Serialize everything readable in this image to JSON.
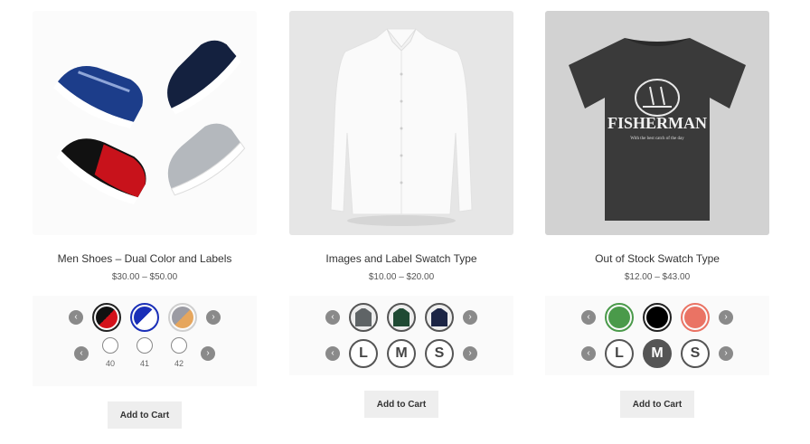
{
  "products": [
    {
      "title": "Men Shoes – Dual Color and Labels",
      "price": "$30.00 – $50.00",
      "color_swatches": [
        {
          "name": "black-red",
          "colors": [
            "#111111",
            "#d4121b"
          ]
        },
        {
          "name": "blue-white",
          "colors": [
            "#1a2fb8",
            "#ffffff"
          ]
        },
        {
          "name": "grey-orange",
          "colors": [
            "#9b9ba3",
            "#e6a65d"
          ]
        }
      ],
      "size_swatches": [
        "40",
        "41",
        "42"
      ],
      "button": "Add to Cart"
    },
    {
      "title": "Images and Label Swatch Type",
      "price": "$10.00 – $20.00",
      "image_swatches": [
        {
          "name": "grey-shirt",
          "color": "#5f6466"
        },
        {
          "name": "green-shirt",
          "color": "#1f4a33"
        },
        {
          "name": "navy-shirt",
          "color": "#1c2545"
        }
      ],
      "label_swatches": [
        "L",
        "M",
        "S"
      ],
      "button": "Add to Cart"
    },
    {
      "title": "Out of Stock Swatch Type",
      "price": "$12.00 – $43.00",
      "color_swatches": [
        {
          "name": "green",
          "color": "#4a9a4a"
        },
        {
          "name": "black",
          "color": "#000000"
        },
        {
          "name": "coral",
          "color": "#ea7364"
        }
      ],
      "label_swatches": [
        "L",
        "M",
        "S"
      ],
      "selected_label": "M",
      "button": "Add to Cart"
    }
  ],
  "tshirt_print": {
    "brand": "FISHERMAN",
    "tagline": "With the best catch of the day"
  },
  "icons": {
    "prev": "‹",
    "next": "›"
  }
}
